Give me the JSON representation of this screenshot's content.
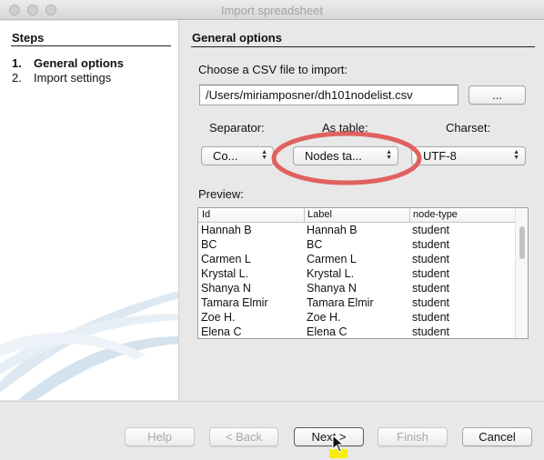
{
  "window": {
    "title": "Import spreadsheet"
  },
  "steps": {
    "title": "Steps",
    "items": [
      {
        "num": "1.",
        "label": "General options",
        "active": true
      },
      {
        "num": "2.",
        "label": "Import settings",
        "active": false
      }
    ]
  },
  "main": {
    "title": "General options",
    "file_label": "Choose a CSV file to import:",
    "file_path": "/Users/miriamposner/dh101nodelist.csv",
    "browse_label": "...",
    "separator": {
      "label": "Separator:",
      "value": "Co..."
    },
    "as_table": {
      "label": "As table:",
      "value": "Nodes ta..."
    },
    "charset": {
      "label": "Charset:",
      "value": "UTF-8"
    },
    "preview_label": "Preview:",
    "preview": {
      "columns": [
        "Id",
        "Label",
        "node-type"
      ],
      "rows": [
        [
          "Hannah B",
          "Hannah B",
          "student"
        ],
        [
          "BC",
          "BC",
          "student"
        ],
        [
          "Carmen L",
          "Carmen L",
          "student"
        ],
        [
          "Krystal L.",
          "Krystal L.",
          "student"
        ],
        [
          "Shanya N",
          "Shanya N",
          "student"
        ],
        [
          "Tamara Elmir",
          "Tamara Elmir",
          "student"
        ],
        [
          "Zoe H.",
          "Zoe H.",
          "student"
        ],
        [
          "Elena C",
          "Elena C",
          "student"
        ]
      ]
    }
  },
  "footer": {
    "help": "Help",
    "back": "< Back",
    "next": "Next >",
    "finish": "Finish",
    "cancel": "Cancel"
  },
  "colors": {
    "highlight_ring": "#e0615f",
    "cursor_highlight": "#f4f000"
  }
}
